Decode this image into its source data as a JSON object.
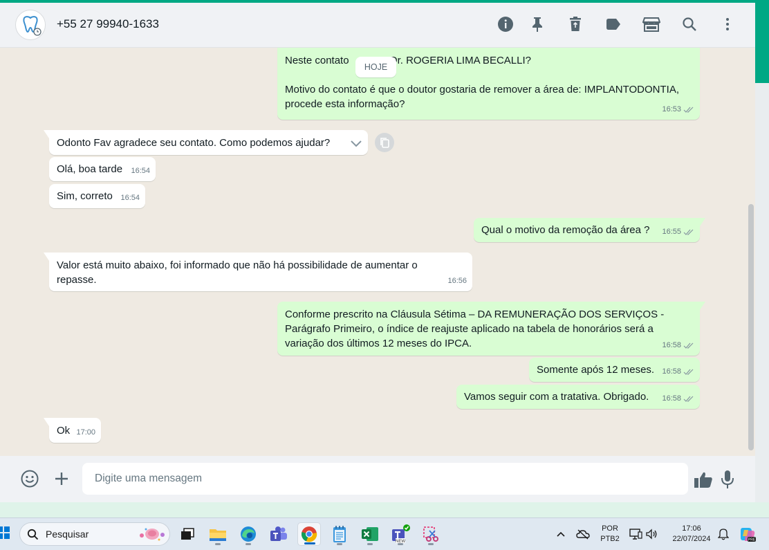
{
  "header": {
    "contact_name": "+55 27 99940-1633",
    "icons": [
      "info-icon",
      "pin-icon",
      "delete-icon",
      "label-icon",
      "store-icon",
      "search-icon",
      "menu-icon"
    ]
  },
  "chat": {
    "date_pill": "HOJE",
    "messages": [
      {
        "dir": "out",
        "text_line1": "Neste contato ",
        "text_line1b": "Dr. ROGERIA LIMA BECALLI?",
        "text_line2": "Motivo do contato é que o doutor gostaria de remover a área de: IMPLANTODONTIA, procede esta informação?",
        "time": "16:53"
      },
      {
        "dir": "in",
        "text": "Odonto Fav agradece seu contato. Como podemos ajudar?",
        "time": "16:54"
      },
      {
        "dir": "in",
        "text": "Olá, boa tarde",
        "time": "16:54"
      },
      {
        "dir": "in",
        "text": "Sim, correto",
        "time": "16:54"
      },
      {
        "dir": "out",
        "text": "Qual o motivo da remoção da área ?",
        "time": "16:55"
      },
      {
        "dir": "in",
        "text": "Valor está muito abaixo, foi informado que não há possibilidade de aumentar o repasse.",
        "time": "16:56"
      },
      {
        "dir": "out",
        "text": "Conforme prescrito na Cláusula Sétima – DA REMUNERAÇÃO DOS SERVIÇOS - Parágrafo Primeiro, o índice de reajuste aplicado na tabela de honorários será a variação dos últimos 12 meses do IPCA.",
        "time": "16:58"
      },
      {
        "dir": "out",
        "text": "Somente após 12 meses.",
        "time": "16:58"
      },
      {
        "dir": "out",
        "text": "Vamos seguir com a tratativa. Obrigado.",
        "time": "16:58"
      },
      {
        "dir": "in",
        "text": "Ok",
        "time": "17:00"
      }
    ]
  },
  "composer": {
    "placeholder": "Digite uma mensagem"
  },
  "taskbar": {
    "search_label": "Pesquisar",
    "lang_line1": "POR",
    "lang_line2": "PTB2",
    "time": "17:06",
    "date": "22/07/2024",
    "apps": [
      "file-explorer",
      "edge",
      "teams",
      "chrome",
      "notepad",
      "excel",
      "teams-new",
      "snipping-tool"
    ]
  },
  "colors": {
    "accent": "#00a884",
    "outgoing_bubble": "#d9fdd3",
    "incoming_bubble": "#ffffff",
    "chat_background": "#efeae2"
  }
}
